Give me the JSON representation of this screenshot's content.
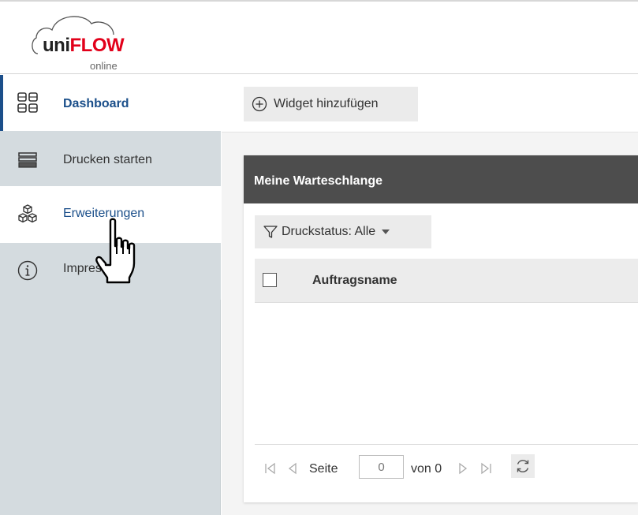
{
  "logo": {
    "brand_prefix": "uni",
    "brand_main": "FLOW",
    "brand_sub": "online"
  },
  "sidebar": {
    "items": [
      {
        "label": "Dashboard",
        "icon": "dashboard-icon",
        "active": true
      },
      {
        "label": "Drucken starten",
        "icon": "printer-tray-icon"
      },
      {
        "label": "Erweiterungen",
        "icon": "cubes-icon",
        "hovered": true
      },
      {
        "label": "Impressum",
        "icon": "info-icon"
      }
    ]
  },
  "toolbar": {
    "add_widget_label": "Widget hinzufügen"
  },
  "queue": {
    "title": "Meine Warteschlange",
    "filter_label": "Druckstatus: Alle",
    "columns": [
      "Auftragsname"
    ],
    "pager": {
      "page_label": "Seite",
      "page_value": "0",
      "of_label": "von 0"
    }
  },
  "colors": {
    "accent": "#1b4f8a",
    "brand_red": "#e2001a",
    "sidebar_bg": "#d4dbdf",
    "panel_header": "#4d4d4d"
  }
}
